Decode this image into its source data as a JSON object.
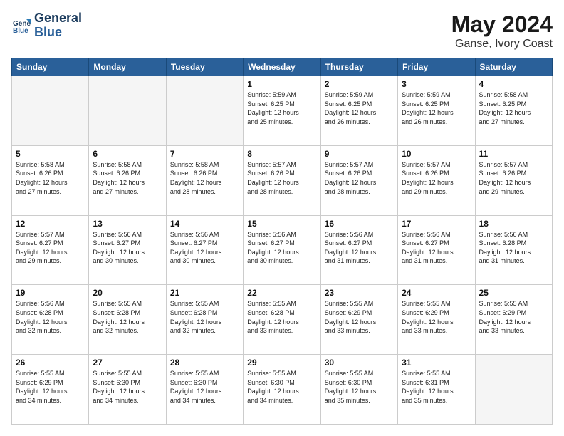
{
  "header": {
    "logo_line1": "General",
    "logo_line2": "Blue",
    "month": "May 2024",
    "location": "Ganse, Ivory Coast"
  },
  "days_of_week": [
    "Sunday",
    "Monday",
    "Tuesday",
    "Wednesday",
    "Thursday",
    "Friday",
    "Saturday"
  ],
  "weeks": [
    [
      {
        "num": "",
        "info": ""
      },
      {
        "num": "",
        "info": ""
      },
      {
        "num": "",
        "info": ""
      },
      {
        "num": "1",
        "info": "Sunrise: 5:59 AM\nSunset: 6:25 PM\nDaylight: 12 hours\nand 25 minutes."
      },
      {
        "num": "2",
        "info": "Sunrise: 5:59 AM\nSunset: 6:25 PM\nDaylight: 12 hours\nand 26 minutes."
      },
      {
        "num": "3",
        "info": "Sunrise: 5:59 AM\nSunset: 6:25 PM\nDaylight: 12 hours\nand 26 minutes."
      },
      {
        "num": "4",
        "info": "Sunrise: 5:58 AM\nSunset: 6:25 PM\nDaylight: 12 hours\nand 27 minutes."
      }
    ],
    [
      {
        "num": "5",
        "info": "Sunrise: 5:58 AM\nSunset: 6:26 PM\nDaylight: 12 hours\nand 27 minutes."
      },
      {
        "num": "6",
        "info": "Sunrise: 5:58 AM\nSunset: 6:26 PM\nDaylight: 12 hours\nand 27 minutes."
      },
      {
        "num": "7",
        "info": "Sunrise: 5:58 AM\nSunset: 6:26 PM\nDaylight: 12 hours\nand 28 minutes."
      },
      {
        "num": "8",
        "info": "Sunrise: 5:57 AM\nSunset: 6:26 PM\nDaylight: 12 hours\nand 28 minutes."
      },
      {
        "num": "9",
        "info": "Sunrise: 5:57 AM\nSunset: 6:26 PM\nDaylight: 12 hours\nand 28 minutes."
      },
      {
        "num": "10",
        "info": "Sunrise: 5:57 AM\nSunset: 6:26 PM\nDaylight: 12 hours\nand 29 minutes."
      },
      {
        "num": "11",
        "info": "Sunrise: 5:57 AM\nSunset: 6:26 PM\nDaylight: 12 hours\nand 29 minutes."
      }
    ],
    [
      {
        "num": "12",
        "info": "Sunrise: 5:57 AM\nSunset: 6:27 PM\nDaylight: 12 hours\nand 29 minutes."
      },
      {
        "num": "13",
        "info": "Sunrise: 5:56 AM\nSunset: 6:27 PM\nDaylight: 12 hours\nand 30 minutes."
      },
      {
        "num": "14",
        "info": "Sunrise: 5:56 AM\nSunset: 6:27 PM\nDaylight: 12 hours\nand 30 minutes."
      },
      {
        "num": "15",
        "info": "Sunrise: 5:56 AM\nSunset: 6:27 PM\nDaylight: 12 hours\nand 30 minutes."
      },
      {
        "num": "16",
        "info": "Sunrise: 5:56 AM\nSunset: 6:27 PM\nDaylight: 12 hours\nand 31 minutes."
      },
      {
        "num": "17",
        "info": "Sunrise: 5:56 AM\nSunset: 6:27 PM\nDaylight: 12 hours\nand 31 minutes."
      },
      {
        "num": "18",
        "info": "Sunrise: 5:56 AM\nSunset: 6:28 PM\nDaylight: 12 hours\nand 31 minutes."
      }
    ],
    [
      {
        "num": "19",
        "info": "Sunrise: 5:56 AM\nSunset: 6:28 PM\nDaylight: 12 hours\nand 32 minutes."
      },
      {
        "num": "20",
        "info": "Sunrise: 5:55 AM\nSunset: 6:28 PM\nDaylight: 12 hours\nand 32 minutes."
      },
      {
        "num": "21",
        "info": "Sunrise: 5:55 AM\nSunset: 6:28 PM\nDaylight: 12 hours\nand 32 minutes."
      },
      {
        "num": "22",
        "info": "Sunrise: 5:55 AM\nSunset: 6:28 PM\nDaylight: 12 hours\nand 33 minutes."
      },
      {
        "num": "23",
        "info": "Sunrise: 5:55 AM\nSunset: 6:29 PM\nDaylight: 12 hours\nand 33 minutes."
      },
      {
        "num": "24",
        "info": "Sunrise: 5:55 AM\nSunset: 6:29 PM\nDaylight: 12 hours\nand 33 minutes."
      },
      {
        "num": "25",
        "info": "Sunrise: 5:55 AM\nSunset: 6:29 PM\nDaylight: 12 hours\nand 33 minutes."
      }
    ],
    [
      {
        "num": "26",
        "info": "Sunrise: 5:55 AM\nSunset: 6:29 PM\nDaylight: 12 hours\nand 34 minutes."
      },
      {
        "num": "27",
        "info": "Sunrise: 5:55 AM\nSunset: 6:30 PM\nDaylight: 12 hours\nand 34 minutes."
      },
      {
        "num": "28",
        "info": "Sunrise: 5:55 AM\nSunset: 6:30 PM\nDaylight: 12 hours\nand 34 minutes."
      },
      {
        "num": "29",
        "info": "Sunrise: 5:55 AM\nSunset: 6:30 PM\nDaylight: 12 hours\nand 34 minutes."
      },
      {
        "num": "30",
        "info": "Sunrise: 5:55 AM\nSunset: 6:30 PM\nDaylight: 12 hours\nand 35 minutes."
      },
      {
        "num": "31",
        "info": "Sunrise: 5:55 AM\nSunset: 6:31 PM\nDaylight: 12 hours\nand 35 minutes."
      },
      {
        "num": "",
        "info": ""
      }
    ]
  ]
}
